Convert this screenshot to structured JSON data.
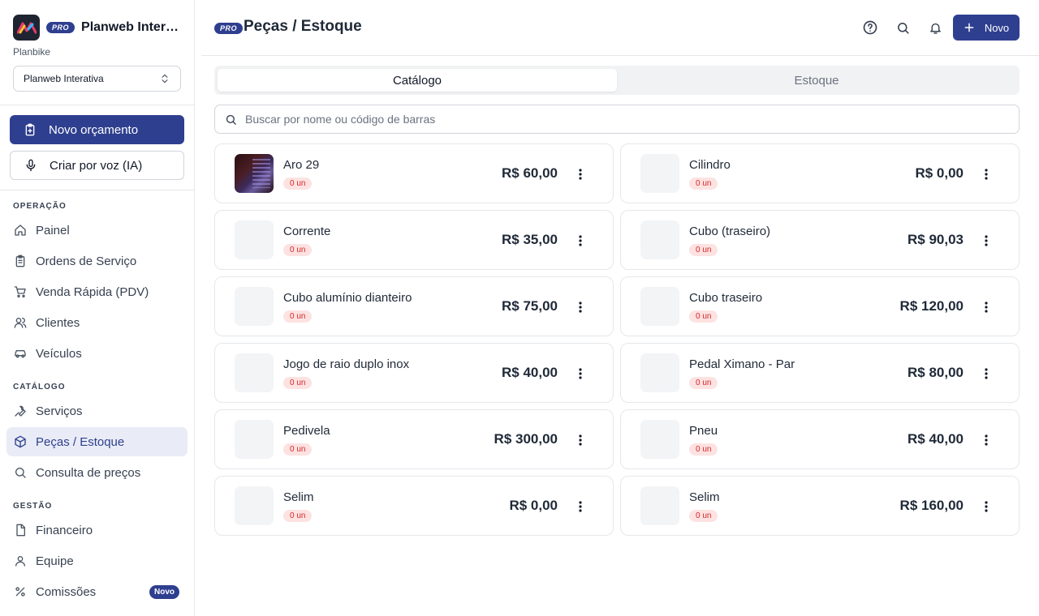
{
  "sidebar": {
    "pro_badge": "PRO",
    "brand_name": "Planweb Interativa",
    "org_label": "Planbike",
    "org_select": "Planweb Interativa",
    "new_quote": "Novo orçamento",
    "voice_create": "Criar por voz (IA)",
    "sections": {
      "operacao": "OPERAÇÃO",
      "catalogo": "CATÁLOGO",
      "gestao": "GESTÃO"
    },
    "items": {
      "painel": "Painel",
      "ordens": "Ordens de Serviço",
      "venda": "Venda Rápida (PDV)",
      "clientes": "Clientes",
      "veiculos": "Veículos",
      "servicos": "Serviços",
      "pecas": "Peças / Estoque",
      "consulta": "Consulta de preços",
      "financeiro": "Financeiro",
      "equipe": "Equipe",
      "comissoes": "Comissões"
    },
    "new_badge": "Novo"
  },
  "header": {
    "pro_badge": "PRO",
    "title": "Peças / Estoque",
    "new_button": "Novo"
  },
  "tabs": {
    "catalogo": "Catálogo",
    "estoque": "Estoque"
  },
  "search": {
    "placeholder": "Buscar por nome ou código de barras"
  },
  "products": [
    {
      "name": "Aro 29",
      "stock": "0 un",
      "price": "R$ 60,00"
    },
    {
      "name": "Cilindro",
      "stock": "0 un",
      "price": "R$ 0,00"
    },
    {
      "name": "Corrente",
      "stock": "0 un",
      "price": "R$ 35,00"
    },
    {
      "name": "Cubo (traseiro)",
      "stock": "0 un",
      "price": "R$ 90,03"
    },
    {
      "name": "Cubo alumínio dianteiro",
      "stock": "0 un",
      "price": "R$ 75,00"
    },
    {
      "name": "Cubo traseiro",
      "stock": "0 un",
      "price": "R$ 120,00"
    },
    {
      "name": "Jogo de raio duplo inox",
      "stock": "0 un",
      "price": "R$ 40,00"
    },
    {
      "name": "Pedal Ximano - Par",
      "stock": "0 un",
      "price": "R$ 80,00"
    },
    {
      "name": "Pedivela",
      "stock": "0 un",
      "price": "R$ 300,00"
    },
    {
      "name": "Pneu",
      "stock": "0 un",
      "price": "R$ 40,00"
    },
    {
      "name": "Selim",
      "stock": "0 un",
      "price": "R$ 0,00"
    },
    {
      "name": "Selim",
      "stock": "0 un",
      "price": "R$ 160,00"
    }
  ],
  "colors": {
    "primary": "#2f3f8f",
    "stock_badge_bg": "#fde2e2",
    "stock_badge_text": "#dc2626"
  }
}
